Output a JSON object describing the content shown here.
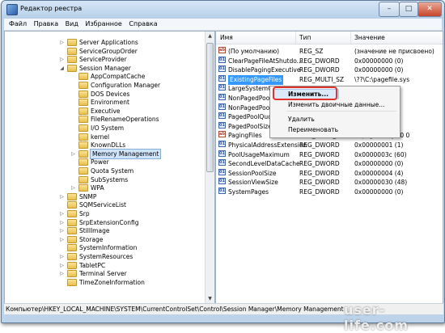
{
  "window": {
    "title": "Редактор реестра",
    "min": "–",
    "max": "□",
    "close": "✕"
  },
  "menu": [
    "Файл",
    "Правка",
    "Вид",
    "Избранное",
    "Справка"
  ],
  "tree": [
    {
      "label": "Server Applications",
      "level": 0,
      "expander": "▷"
    },
    {
      "label": "ServiceGroupOrder",
      "level": 0,
      "expander": ""
    },
    {
      "label": "ServiceProvider",
      "level": 0,
      "expander": "▷"
    },
    {
      "label": "Session Manager",
      "level": 0,
      "expander": "◢"
    },
    {
      "label": "AppCompatCache",
      "level": 1,
      "expander": ""
    },
    {
      "label": "Configuration Manager",
      "level": 1,
      "expander": ""
    },
    {
      "label": "DOS Devices",
      "level": 1,
      "expander": ""
    },
    {
      "label": "Environment",
      "level": 1,
      "expander": ""
    },
    {
      "label": "Executive",
      "level": 1,
      "expander": ""
    },
    {
      "label": "FileRenameOperations",
      "level": 1,
      "expander": ""
    },
    {
      "label": "I/O System",
      "level": 1,
      "expander": ""
    },
    {
      "label": "kernel",
      "level": 1,
      "expander": ""
    },
    {
      "label": "KnownDLLs",
      "level": 1,
      "expander": ""
    },
    {
      "label": "Memory Management",
      "level": 1,
      "expander": "▷",
      "selected": true
    },
    {
      "label": "Power",
      "level": 1,
      "expander": ""
    },
    {
      "label": "Quota System",
      "level": 1,
      "expander": ""
    },
    {
      "label": "SubSystems",
      "level": 1,
      "expander": ""
    },
    {
      "label": "WPA",
      "level": 1,
      "expander": "▷"
    },
    {
      "label": "SNMP",
      "level": 0,
      "expander": "▷"
    },
    {
      "label": "SQMServiceList",
      "level": 0,
      "expander": ""
    },
    {
      "label": "Srp",
      "level": 0,
      "expander": "▷"
    },
    {
      "label": "SrpExtensionConfig",
      "level": 0,
      "expander": "▷"
    },
    {
      "label": "StillImage",
      "level": 0,
      "expander": "▷"
    },
    {
      "label": "Storage",
      "level": 0,
      "expander": "▷"
    },
    {
      "label": "SystemInformation",
      "level": 0,
      "expander": ""
    },
    {
      "label": "SystemResources",
      "level": 0,
      "expander": "▷"
    },
    {
      "label": "TabletPC",
      "level": 0,
      "expander": "▷"
    },
    {
      "label": "Terminal Server",
      "level": 0,
      "expander": "▷"
    },
    {
      "label": "TimeZoneInformation",
      "level": 0,
      "expander": ""
    }
  ],
  "columns": {
    "name": "Имя",
    "type": "Тип",
    "data": "Значение"
  },
  "values": [
    {
      "name": "(По умолчанию)",
      "type": "REG_SZ",
      "data": "(значение не присвоено)",
      "icon": "ab"
    },
    {
      "name": "ClearPageFileAtShutdo...",
      "type": "REG_DWORD",
      "data": "0x00000000 (0)",
      "icon": "bin"
    },
    {
      "name": "DisablePagingExecutive",
      "type": "REG_DWORD",
      "data": "0x00000000 (0)",
      "icon": "bin"
    },
    {
      "name": "ExistingPageFiles",
      "type": "REG_MULTI_SZ",
      "data": "\\??\\C:\\pagefile.sys",
      "icon": "bin",
      "selected": true
    },
    {
      "name": "LargeSystemCache",
      "type": "",
      "data": "",
      "icon": "bin"
    },
    {
      "name": "NonPagedPoolQuota",
      "type": "",
      "data": "",
      "icon": "bin"
    },
    {
      "name": "NonPagedPoolSize",
      "type": "",
      "data": "",
      "icon": "bin"
    },
    {
      "name": "PagedPoolQuota",
      "type": "",
      "data": "",
      "icon": "bin"
    },
    {
      "name": "PagedPoolSize",
      "type": "",
      "data": "295)",
      "icon": "bin"
    },
    {
      "name": "PagingFiles",
      "type": "REG_MULTI_SZ",
      "data": "c:\\pagefile.sys 0 0",
      "icon": "ab"
    },
    {
      "name": "PhysicalAddressExtension",
      "type": "REG_DWORD",
      "data": "0x00000001 (1)",
      "icon": "bin"
    },
    {
      "name": "PoolUsageMaximum",
      "type": "REG_DWORD",
      "data": "0x0000003c (60)",
      "icon": "bin"
    },
    {
      "name": "SecondLevelDataCache",
      "type": "REG_DWORD",
      "data": "0x00000000 (0)",
      "icon": "bin"
    },
    {
      "name": "SessionPoolSize",
      "type": "REG_DWORD",
      "data": "0x00000004 (4)",
      "icon": "bin"
    },
    {
      "name": "SessionViewSize",
      "type": "REG_DWORD",
      "data": "0x00000030 (48)",
      "icon": "bin"
    },
    {
      "name": "SystemPages",
      "type": "REG_DWORD",
      "data": "0x00000000 (0)",
      "icon": "bin"
    }
  ],
  "context_menu": {
    "modify": "Изменить...",
    "modify_binary": "Изменить двоичные данные...",
    "delete": "Удалить",
    "rename": "Переименовать"
  },
  "status_path": "Компьютер\\HKEY_LOCAL_MACHINE\\SYSTEM\\CurrentControlSet\\Control\\Session Manager\\Memory Management",
  "watermark": "user-life.com",
  "colors": {
    "selection": "#3399ff",
    "highlight_ring": "#e2332a"
  }
}
